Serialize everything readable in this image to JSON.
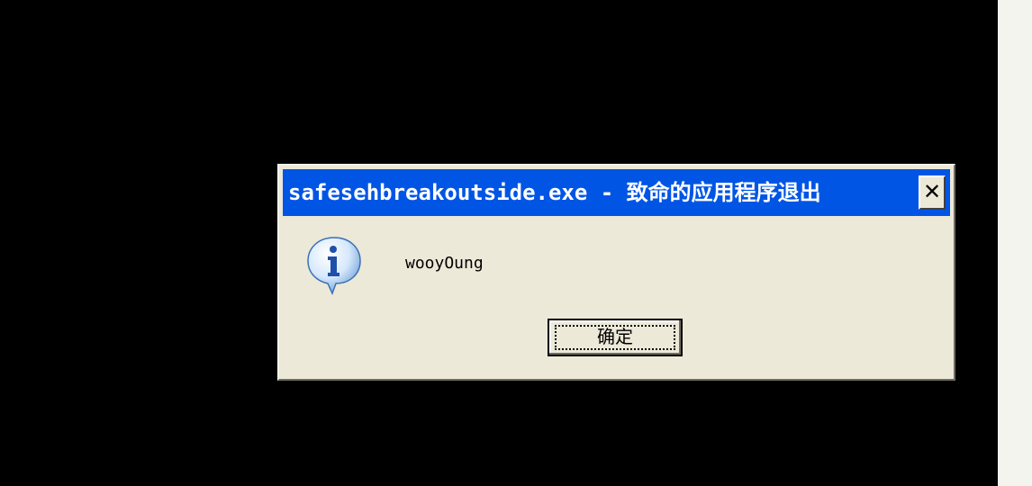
{
  "dialog": {
    "title": "safesehbreakoutside.exe - 致命的应用程序退出",
    "close_label": "✕",
    "message": "wooyOung",
    "ok_label": "确定",
    "icon": "information-icon"
  },
  "colors": {
    "desktop": "#000000",
    "title_bar": "#0055e5",
    "dialog_face": "#ece9d8",
    "title_text": "#ffffff"
  }
}
